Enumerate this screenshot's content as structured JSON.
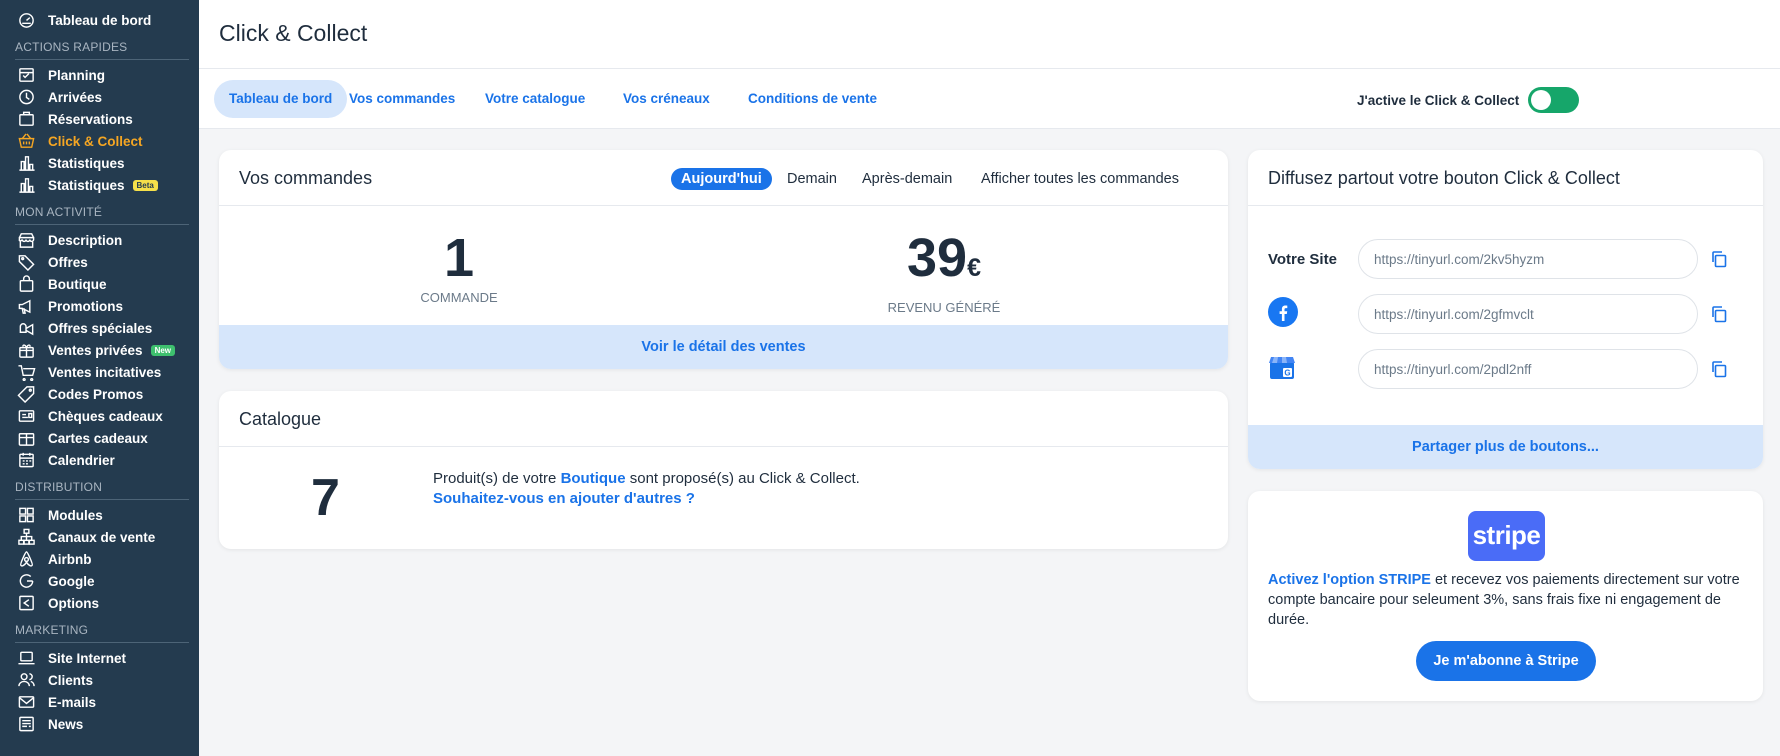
{
  "sidebar": {
    "top": {
      "label": "Tableau de bord",
      "icon": "dashboard-icon"
    },
    "sections": [
      {
        "title": "ACTIONS RAPIDES",
        "items": [
          {
            "label": "Planning",
            "icon": "planning-icon"
          },
          {
            "label": "Arrivées",
            "icon": "clock-icon"
          },
          {
            "label": "Réservations",
            "icon": "reservations-icon"
          },
          {
            "label": "Click & Collect",
            "icon": "basket-icon",
            "active": true
          },
          {
            "label": "Statistiques",
            "icon": "bar-chart-icon"
          },
          {
            "label": "Statistiques",
            "icon": "bar-chart-icon",
            "badge": "Beta"
          }
        ]
      },
      {
        "title": "MON ACTIVITÉ",
        "items": [
          {
            "label": "Description",
            "icon": "storefront-icon"
          },
          {
            "label": "Offres",
            "icon": "tag-icon"
          },
          {
            "label": "Boutique",
            "icon": "shopping-bag-icon"
          },
          {
            "label": "Promotions",
            "icon": "megaphone-icon"
          },
          {
            "label": "Offres spéciales",
            "icon": "special-offer-icon"
          },
          {
            "label": "Ventes privées",
            "icon": "gift-icon",
            "badge": "New"
          },
          {
            "label": "Ventes incitatives",
            "icon": "cart-icon"
          },
          {
            "label": "Codes Promos",
            "icon": "promo-tag-icon"
          },
          {
            "label": "Chèques cadeaux",
            "icon": "voucher-icon"
          },
          {
            "label": "Cartes cadeaux",
            "icon": "gift-card-icon"
          },
          {
            "label": "Calendrier",
            "icon": "calendar-icon"
          }
        ]
      },
      {
        "title": "DISTRIBUTION",
        "items": [
          {
            "label": "Modules",
            "icon": "grid-icon"
          },
          {
            "label": "Canaux de vente",
            "icon": "network-icon"
          },
          {
            "label": "Airbnb",
            "icon": "airbnb-icon"
          },
          {
            "label": "Google",
            "icon": "google-icon"
          },
          {
            "label": "Options",
            "icon": "options-icon"
          }
        ]
      },
      {
        "title": "MARKETING",
        "items": [
          {
            "label": "Site Internet",
            "icon": "laptop-icon"
          },
          {
            "label": "Clients",
            "icon": "users-icon"
          },
          {
            "label": "E-mails",
            "icon": "mail-icon"
          },
          {
            "label": "News",
            "icon": "news-icon"
          }
        ]
      }
    ]
  },
  "header": {
    "title": "Click & Collect"
  },
  "tabs": [
    {
      "label": "Tableau de bord",
      "active": true
    },
    {
      "label": "Vos commandes"
    },
    {
      "label": "Votre catalogue"
    },
    {
      "label": "Vos créneaux"
    },
    {
      "label": "Conditions de vente"
    }
  ],
  "toggle": {
    "label": "J'active le Click & Collect",
    "on": true,
    "color": "#16a66a"
  },
  "orders": {
    "title": "Vos commandes",
    "periods": [
      "Aujourd'hui",
      "Demain",
      "Après-demain",
      "Afficher toutes les commandes"
    ],
    "active_period": "Aujourd'hui",
    "count": "1",
    "count_label": "COMMANDE",
    "revenue": "39",
    "currency": "€",
    "revenue_label": "REVENU GÉNÉRÉ",
    "footer_link": "Voir le détail des ventes"
  },
  "catalogue": {
    "title": "Catalogue",
    "count": "7",
    "text_before": "Produit(s) de votre ",
    "link_boutique": "Boutique",
    "text_after": " sont proposé(s) au Click & Collect.",
    "add_link": "Souhaitez-vous en ajouter d'autres ?"
  },
  "share": {
    "title": "Diffusez partout votre bouton Click & Collect",
    "site_label": "Votre Site",
    "links": [
      {
        "channel": "site",
        "url": "https://tinyurl.com/2kv5hyzm"
      },
      {
        "channel": "facebook",
        "icon": "facebook-icon",
        "url": "https://tinyurl.com/2gfmvclt"
      },
      {
        "channel": "google-business",
        "icon": "google-business-icon",
        "url": "https://tinyurl.com/2pdl2nff"
      }
    ],
    "footer_link": "Partager plus de boutons..."
  },
  "stripe": {
    "logo": "stripe",
    "link": "Activez l'option STRIPE",
    "text": " et recevez vos paiements directement sur votre compte bancaire pour seleument 3%, sans frais fixe ni engagement de durée.",
    "button": "Je m'abonne à Stripe",
    "brand_color": "#4a6cf7"
  },
  "colors": {
    "sidebar": "#243b4f",
    "accent": "#1a73e8",
    "active_nav": "#f5a623",
    "light_accent": "#d6e6fb"
  }
}
